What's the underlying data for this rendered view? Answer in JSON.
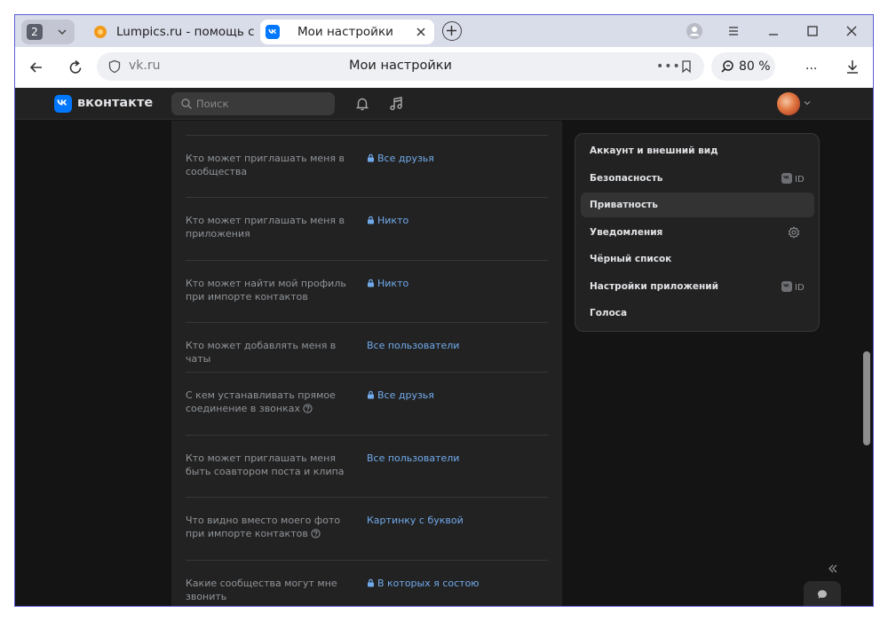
{
  "browser": {
    "tab_count": "2",
    "tabs": [
      {
        "title": "Lumpics.ru - помощь с компьютером",
        "active": false,
        "favicon": "orange-circle-icon"
      },
      {
        "title": "Мои настройки",
        "active": true,
        "favicon": "vk-icon"
      }
    ],
    "address": {
      "domain": "vk.ru",
      "page_title": "Мои настройки",
      "more": "•••"
    },
    "zoom": "80 %",
    "menu_label": "..."
  },
  "vk": {
    "logo_text": "вконтакте",
    "search_placeholder": "Поиск",
    "accent": "#0077ff",
    "link_color": "#71aaeb"
  },
  "privacy_rows": [
    {
      "label": "Кто может приглашать меня в сообщества",
      "value": "Все друзья",
      "locked": true,
      "help": false
    },
    {
      "label": "Кто может приглашать меня в приложения",
      "value": "Никто",
      "locked": true,
      "help": false
    },
    {
      "label": "Кто может найти мой профиль при импорте контактов",
      "value": "Никто",
      "locked": true,
      "help": false
    },
    {
      "label": "Кто может добавлять меня в чаты",
      "value": "Все пользователи",
      "locked": false,
      "help": false
    },
    {
      "label": "С кем устанавливать прямое соединение в звонках",
      "value": "Все друзья",
      "locked": true,
      "help": true
    },
    {
      "label": "Кто может приглашать меня быть соавтором поста и клипа",
      "value": "Все пользователи",
      "locked": false,
      "help": false
    },
    {
      "label": "Что видно вместо моего фото при импорте контактов",
      "value": "Картинку с буквой",
      "locked": false,
      "help": true
    },
    {
      "label": "Какие сообщества могут мне звонить",
      "value": "В которых я состою",
      "locked": true,
      "help": false
    }
  ],
  "settings_menu": [
    {
      "label": "Аккаунт и внешний вид",
      "active": false,
      "badge": ""
    },
    {
      "label": "Безопасность",
      "active": false,
      "badge": "vkid"
    },
    {
      "label": "Приватность",
      "active": true,
      "badge": ""
    },
    {
      "label": "Уведомления",
      "active": false,
      "badge": "gear"
    },
    {
      "label": "Чёрный список",
      "active": false,
      "badge": ""
    },
    {
      "label": "Настройки приложений",
      "active": false,
      "badge": "vkid"
    },
    {
      "label": "Голоса",
      "active": false,
      "badge": ""
    }
  ]
}
